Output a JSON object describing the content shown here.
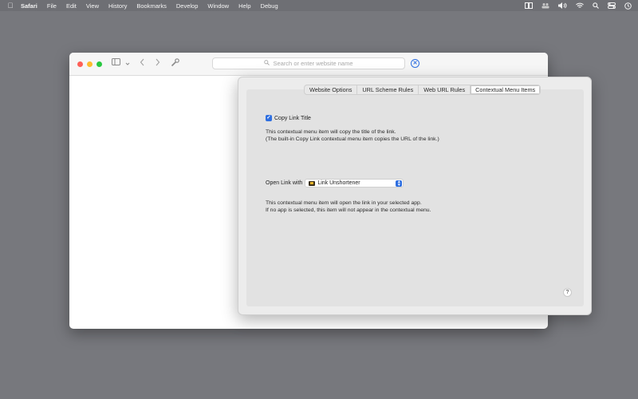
{
  "menubar": {
    "apple_icon": "apple-icon",
    "items": [
      "Safari",
      "File",
      "Edit",
      "View",
      "History",
      "Bookmarks",
      "Develop",
      "Window",
      "Help",
      "Debug"
    ]
  },
  "toolbar": {
    "address_placeholder": "Search or enter website name"
  },
  "popover": {
    "tabs": [
      "Website Options",
      "URL Scheme Rules",
      "Web URL Rules",
      "Contextual Menu Items"
    ],
    "active_tab": "Contextual Menu Items",
    "copy_link_title": {
      "label": "Copy Link Title",
      "checked": true,
      "desc_line1": "This contextual menu item will copy the title of the link.",
      "desc_line2": "(The built-in Copy Link contextual menu item copies the URL of the link.)"
    },
    "open_link_with": {
      "label": "Open Link with",
      "selected_app": "Link Unshortener",
      "desc_line1": "This contextual menu item will open the link in your selected app.",
      "desc_line2": "If no app is selected, this item will not appear in the contextual menu."
    },
    "help_label": "?"
  },
  "colors": {
    "desktop": "#77787d",
    "accent": "#2f6fe0"
  }
}
